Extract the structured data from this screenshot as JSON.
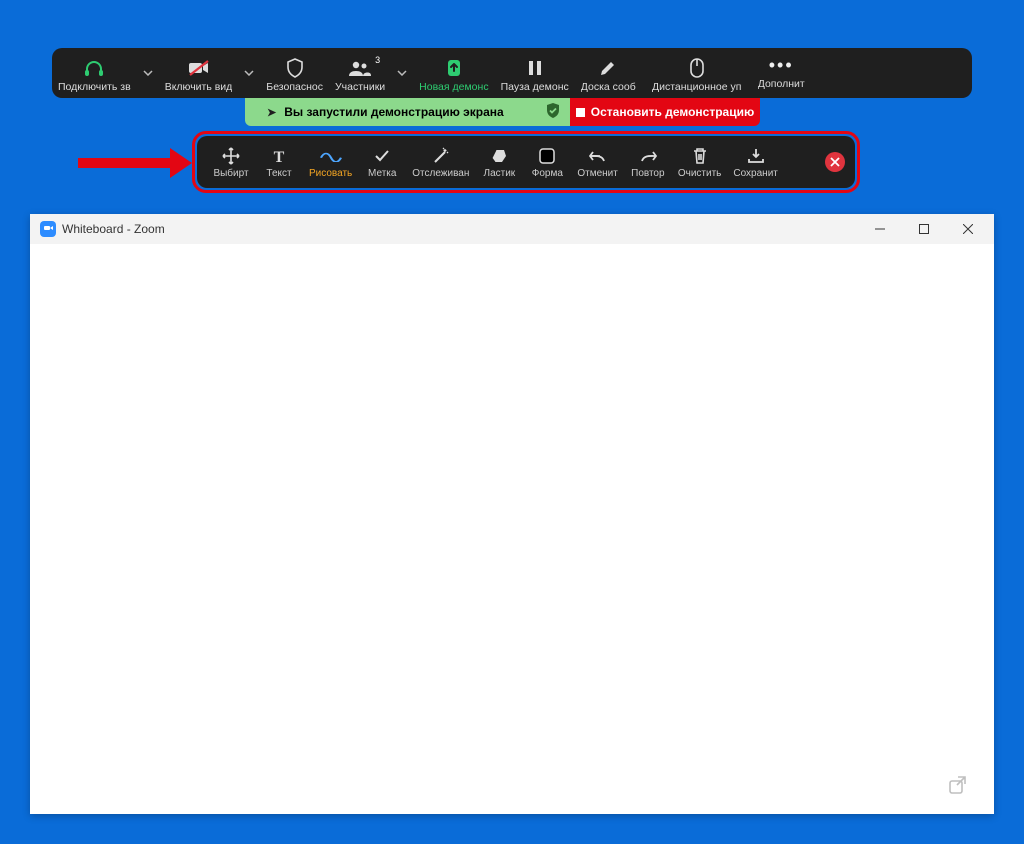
{
  "toolbar": {
    "audio": "Подключить зв",
    "video": "Включить вид",
    "security": "Безопаснос",
    "participants": "Участники",
    "participants_count": "3",
    "new_share": "Новая демонс",
    "pause_share": "Пауза демонс",
    "whiteboard": "Доска сооб",
    "remote_control": "Дистанционное уп",
    "more": "Дополнит"
  },
  "share_bar": {
    "message": "Вы запустили демонстрацию экрана",
    "stop": "Остановить демонстрацию"
  },
  "annotate": {
    "select": "Выбирт",
    "text": "Текст",
    "draw": "Рисовать",
    "stamp": "Метка",
    "spotlight": "Отслеживан",
    "eraser": "Ластик",
    "format": "Форма",
    "undo": "Отменит",
    "redo": "Повтор",
    "clear": "Очистить",
    "save": "Сохранит"
  },
  "window": {
    "title": "Whiteboard - Zoom"
  }
}
